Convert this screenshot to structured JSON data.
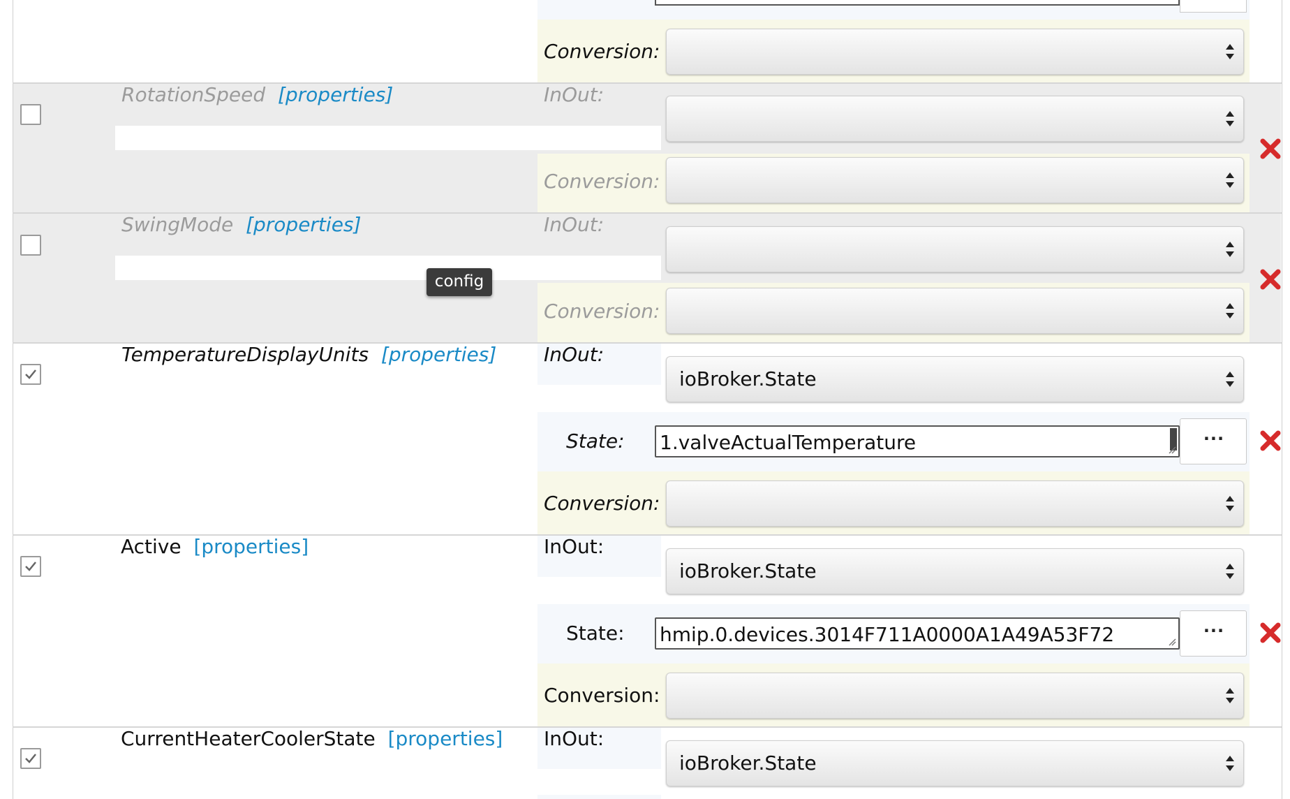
{
  "common": {
    "inout_label": "InOut:",
    "conversion_label": "Conversion:",
    "state_label": "State:",
    "properties_link": "[properties]",
    "browse_label": "···"
  },
  "tooltip": {
    "text": "config"
  },
  "rows": [
    {
      "name": "RotationSpeed",
      "checked": false,
      "enabled": false,
      "inout_value": "",
      "conversion_value": ""
    },
    {
      "name": "SwingMode",
      "checked": false,
      "enabled": false,
      "inout_value": "",
      "conversion_value": ""
    },
    {
      "name": "TemperatureDisplayUnits",
      "checked": true,
      "enabled": true,
      "inout_value": "ioBroker.State",
      "state_value": "1.valveActualTemperature",
      "conversion_value": ""
    },
    {
      "name": "Active",
      "checked": true,
      "enabled": true,
      "inout_value": "ioBroker.State",
      "state_value": "hmip.0.devices.3014F711A0000A1A49A53F72",
      "conversion_value": ""
    },
    {
      "name": "CurrentHeaterCoolerState",
      "checked": true,
      "enabled": true,
      "inout_value": "ioBroker.State"
    }
  ],
  "colors": {
    "link": "#1a8ac6",
    "delete": "#d62b2b",
    "disabled_row": "#ececec",
    "conversion_panel": "#f8f8e8",
    "inout_panel": "#f5f8fc"
  }
}
